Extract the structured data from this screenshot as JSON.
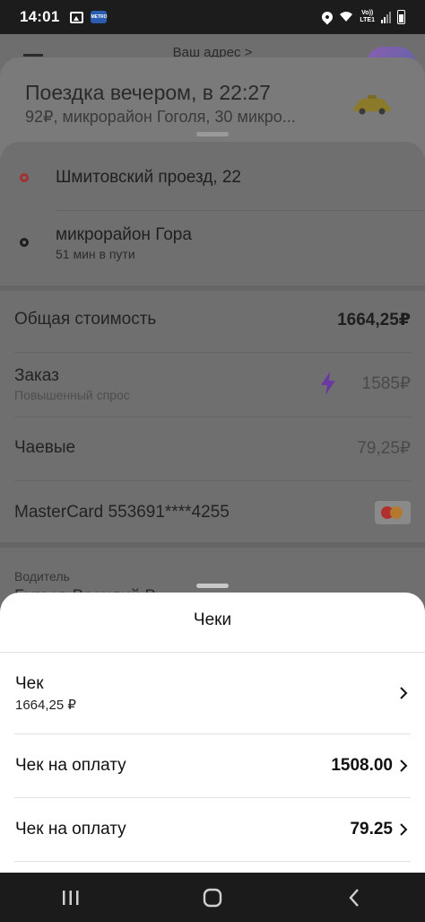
{
  "status_bar": {
    "time": "14:01",
    "app_badge": "METRO",
    "volte_line1": "Vo))",
    "volte_line2": "LTE1"
  },
  "map": {
    "address_label": "Ваш адрес >"
  },
  "trip": {
    "title": "Поездка вечером, в 22:27",
    "subtitle": "92₽, микрорайон Гоголя, 30 микро..."
  },
  "route": {
    "from": "Шмитовский проезд, 22",
    "to": "микрорайон Гора",
    "to_sub": "51 мин в пути"
  },
  "pricing": {
    "total_label": "Общая стоимость",
    "total_value": "1664,25₽",
    "order_label": "Заказ",
    "order_sub": "Повышенный спрос",
    "order_value": "1585₽",
    "tips_label": "Чаевые",
    "tips_value": "79,25₽",
    "card_label": "MasterCard 553691****4255"
  },
  "driver": {
    "label": "Водитель",
    "name": "Бугаев Василий В..."
  },
  "receipts_sheet": {
    "title": "Чеки",
    "items": [
      {
        "label": "Чек",
        "sub": "1664,25 ₽",
        "amount": ""
      },
      {
        "label": "Чек на оплату",
        "sub": "",
        "amount": "1508.00"
      },
      {
        "label": "Чек на оплату",
        "sub": "",
        "amount": "79.25"
      }
    ]
  },
  "colors": {
    "accent_dot": "#a23030",
    "bolt": "#6a3aa0",
    "sheet_bg": "#ffffff",
    "dim_bg": "#6f6f6f"
  }
}
